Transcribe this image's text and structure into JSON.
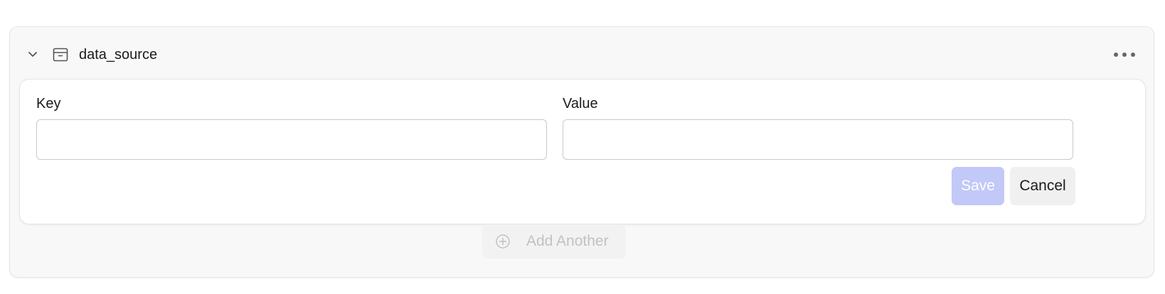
{
  "section": {
    "title": "data_source",
    "icons": {
      "collapse": "chevron-down-icon",
      "type": "archive-box-icon",
      "menu": "more-horizontal-icon"
    }
  },
  "form": {
    "key_label": "Key",
    "key_value": "",
    "value_label": "Value",
    "value_value": "",
    "save_label": "Save",
    "cancel_label": "Cancel"
  },
  "footer": {
    "add_another_label": "Add Another",
    "add_icon": "plus-circle-icon"
  },
  "colors": {
    "save_disabled_bg": "#c2c8f8",
    "card_bg": "#f8f8f8"
  }
}
